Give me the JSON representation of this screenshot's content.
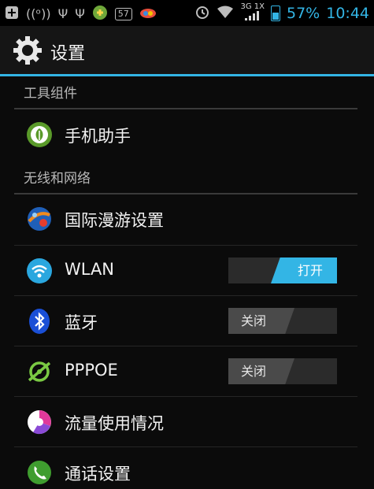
{
  "status_bar": {
    "notification_number": "57",
    "network_label": "3G 1X",
    "battery_percent": "57%",
    "time": "10:44"
  },
  "action_bar": {
    "title": "设置"
  },
  "sections": [
    {
      "header": "工具组件",
      "items": [
        {
          "label": "手机助手",
          "icon": "phone-assistant-icon"
        }
      ]
    },
    {
      "header": "无线和网络",
      "items": [
        {
          "label": "国际漫游设置",
          "icon": "roaming-globe-icon"
        },
        {
          "label": "WLAN",
          "icon": "wifi-icon",
          "toggle": "打开"
        },
        {
          "label": "蓝牙",
          "icon": "bluetooth-icon",
          "toggle": "关闭"
        },
        {
          "label": "PPPOE",
          "icon": "pppoe-icon",
          "toggle": "关闭"
        },
        {
          "label": "流量使用情况",
          "icon": "data-usage-icon"
        },
        {
          "label": "通话设置",
          "icon": "call-icon"
        }
      ]
    }
  ],
  "colors": {
    "accent": "#33b5e5",
    "background": "#0b0b0b",
    "toggle_off": "#4a4a4a"
  }
}
